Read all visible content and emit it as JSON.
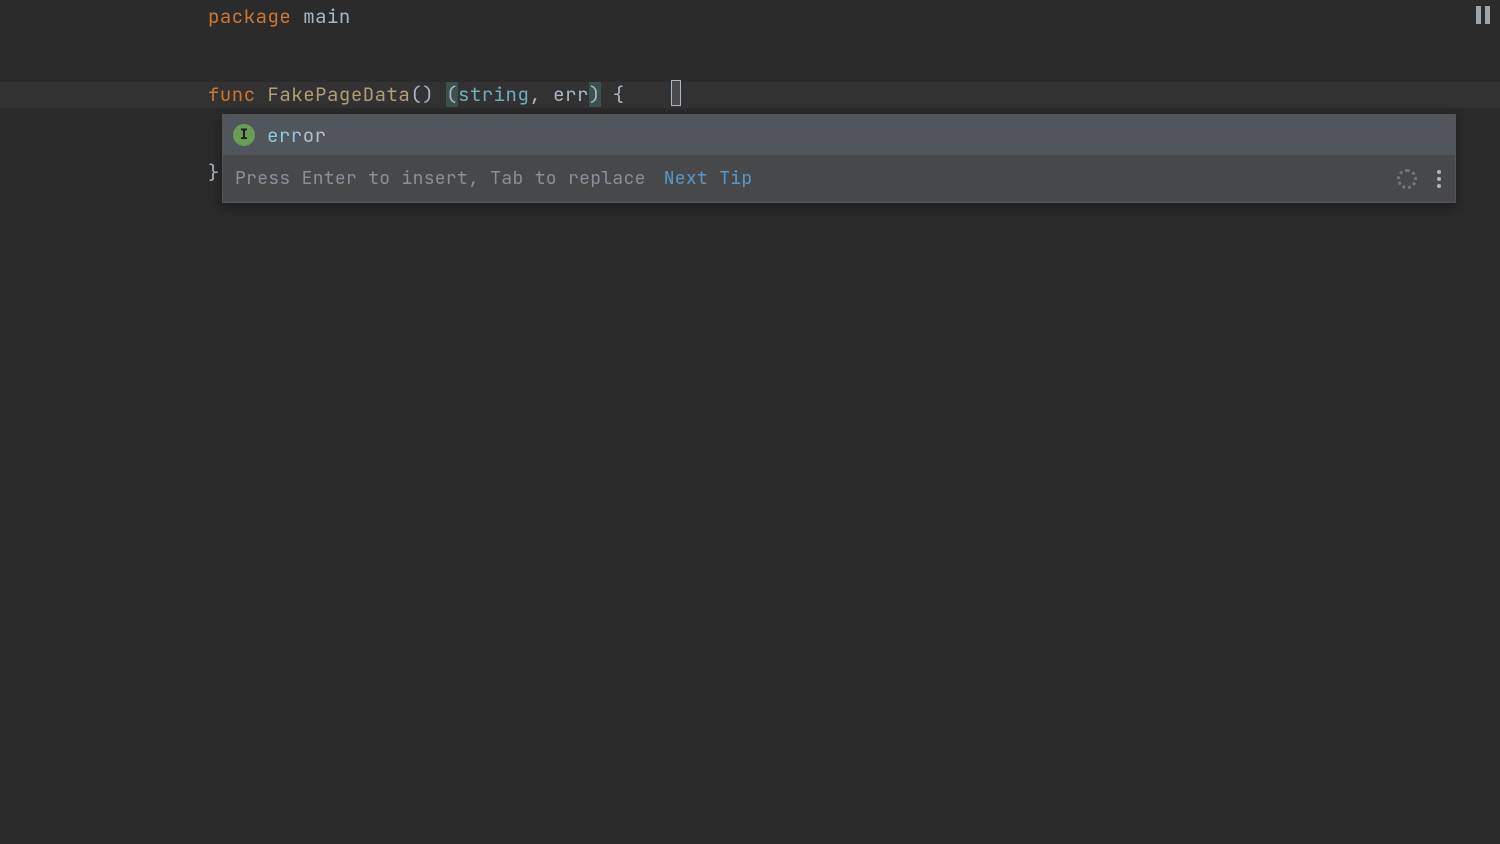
{
  "code": {
    "line1": {
      "keyword": "package",
      "name": "main"
    },
    "line3": {
      "keyword": "func",
      "funcName": "FakePageData",
      "parens": "()",
      "openRet": "(",
      "type1": "string",
      "comma": ", ",
      "typed": "err",
      "closeRet": ")",
      "brace": " {"
    },
    "line5": "}"
  },
  "completion": {
    "items": [
      {
        "icon": "I",
        "matched": "err",
        "rest": "or"
      }
    ],
    "hint": "Press Enter to insert, Tab to replace",
    "nextTip": "Next Tip"
  }
}
